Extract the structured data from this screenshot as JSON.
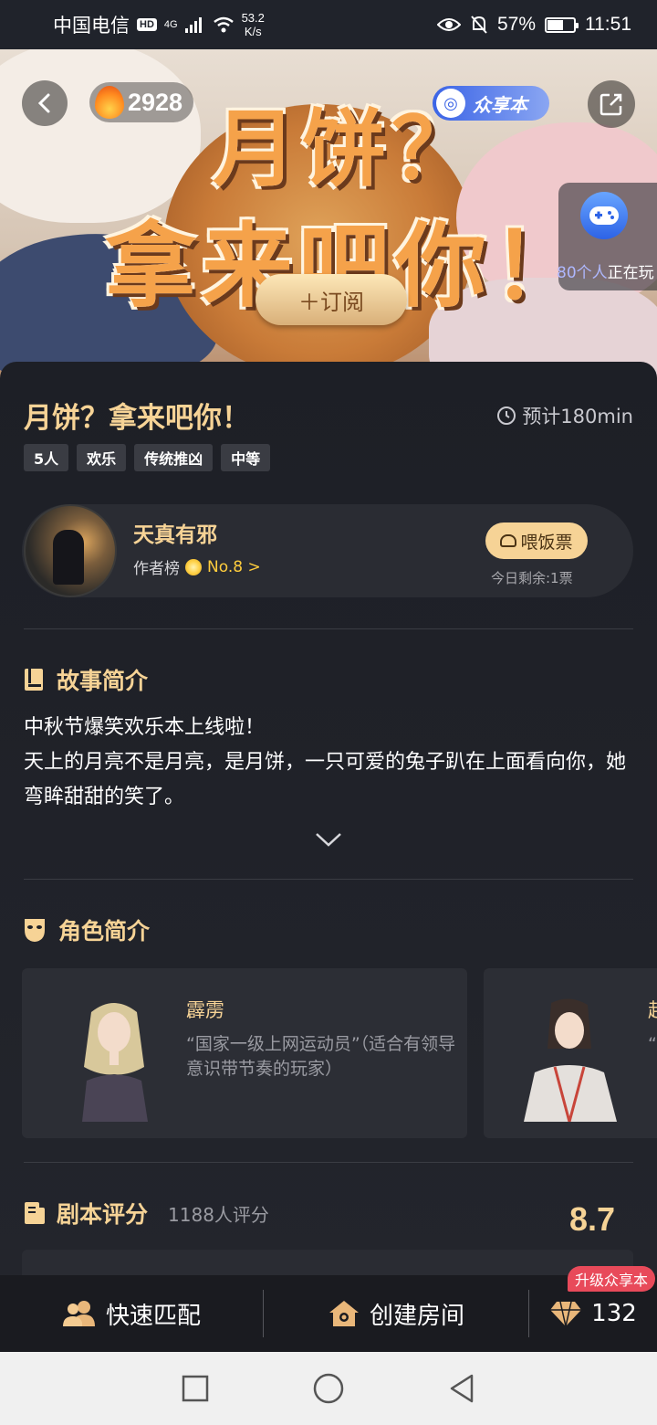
{
  "status_bar": {
    "carrier": "中国电信",
    "hd": "HD",
    "network": "4G",
    "net_speed_value": "53.2",
    "net_speed_unit": "K/s",
    "battery_pct": "57%",
    "battery_level": 0.57,
    "time": "11:51"
  },
  "hero": {
    "art_title_line1": "月饼？",
    "art_title_line2": "拿来吧你！",
    "heat_count": "2928",
    "share_label": "众享本",
    "subscribe_label": "＋订阅",
    "playing_count": "80个人",
    "playing_suffix": "正在玩"
  },
  "script": {
    "title": "月饼？拿来吧你！",
    "duration": "预计180min",
    "tags": [
      "5人",
      "欢乐",
      "传统推凶",
      "中等"
    ]
  },
  "author": {
    "name": "天真有邪",
    "rank_label": "作者榜",
    "rank_no": "No.8 >",
    "ticket_label": "喂饭票",
    "ticket_remaining": "今日剩余:1票"
  },
  "story": {
    "heading": "故事简介",
    "lines": [
      "中秋节爆笑欢乐本上线啦！",
      "天上的月亮不是月亮，是月饼，一只可爱的兔子趴在上面看向你，她弯眸甜甜的笑了。"
    ]
  },
  "roles": {
    "heading": "角色简介",
    "items": [
      {
        "name": "霹雳",
        "desc": "“国家一级上网运动员”（适合有领导意识带节奏的玩家）"
      },
      {
        "name": "赵",
        "desc": "“"
      }
    ]
  },
  "rating": {
    "heading": "剧本评分",
    "count": "1188人评分",
    "score": "8.7"
  },
  "action_bar": {
    "quick_match": "快速匹配",
    "create_room": "创建房间",
    "gems": "132",
    "upgrade_badge": "升级众享本"
  },
  "colors": {
    "accent_gold": "#f6d396",
    "background": "#1d1f26",
    "badge_red": "#e84a5a"
  },
  "icons": [
    "back-arrow-icon",
    "flame-icon",
    "share-external-icon",
    "gamepad-icon",
    "clock-icon",
    "medal-icon",
    "rice-ticket-icon",
    "book-icon",
    "chevron-down-icon",
    "mask-icon",
    "script-icon",
    "users-icon",
    "house-icon",
    "diamond-icon",
    "nav-square-icon",
    "nav-circle-icon",
    "nav-back-icon"
  ]
}
